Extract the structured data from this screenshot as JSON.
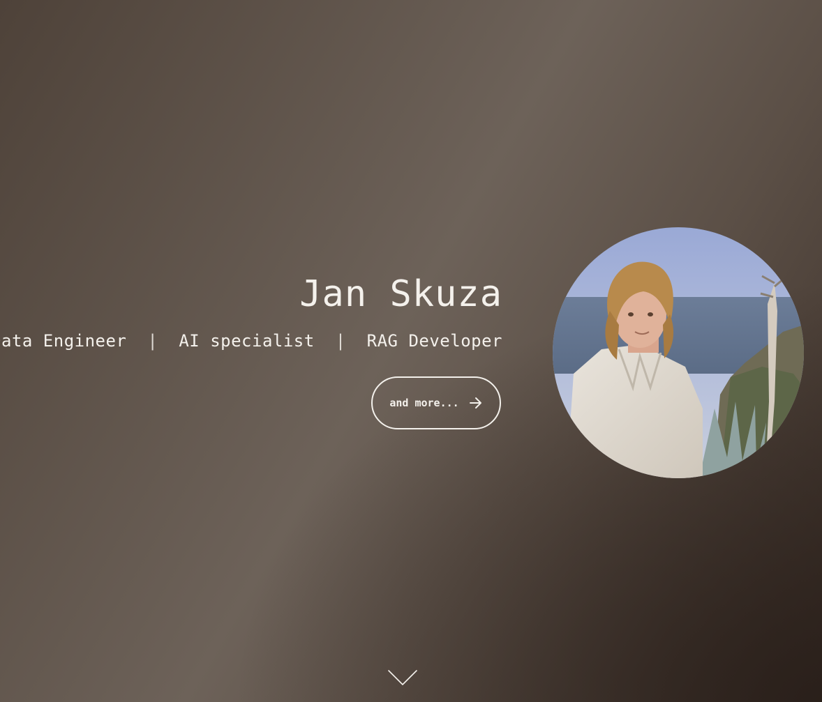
{
  "hero": {
    "name": "Jan Skuza",
    "roles": [
      "Data Engineer",
      "AI specialist",
      "RAG Developer"
    ],
    "separator": "|",
    "more_button_label": "and more...",
    "more_button_icon": "arrow-right-icon",
    "scroll_icon": "chevron-down-icon",
    "avatar_image": "profile-photo"
  },
  "colors": {
    "text": "#f4f1ec",
    "background_light": "#6d6259",
    "background_dark": "#3a2e27"
  }
}
